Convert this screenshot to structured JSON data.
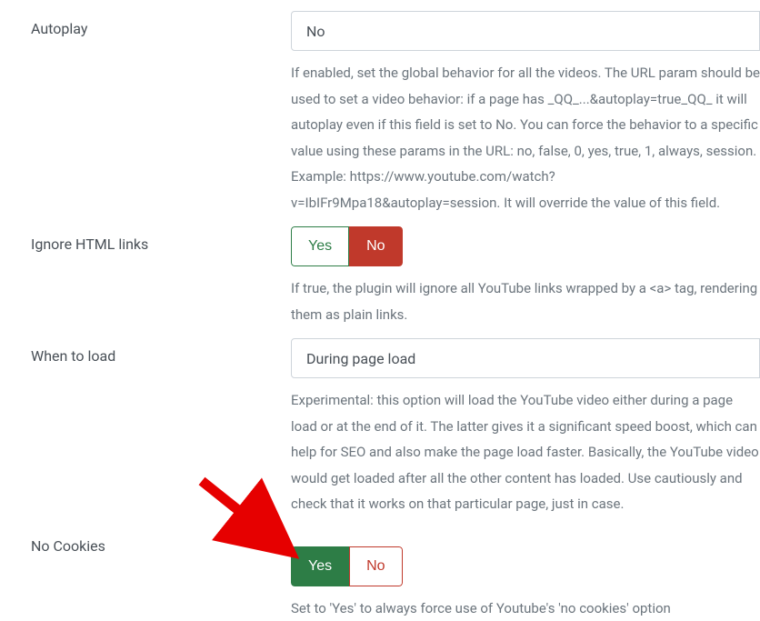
{
  "fields": {
    "autoplay": {
      "label": "Autoplay",
      "select_value": "No",
      "help": "If enabled, set the global behavior for all the videos. The URL param should be used to set a video behavior: if a page has _QQ_...&autoplay=true_QQ_ it will autoplay even if this field is set to No. You can force the behavior to a specific value using these params in the URL: no, false, 0, yes, true, 1, always, session. Example: https://www.youtube.com/watch?v=IbIFr9Mpa18&autoplay=session. It will override the value of this field."
    },
    "ignore_links": {
      "label": "Ignore HTML links",
      "btn_yes": "Yes",
      "btn_no": "No",
      "help": "If true, the plugin will ignore all YouTube links wrapped by a <a> tag, rendering them as plain links."
    },
    "when_to_load": {
      "label": "When to load",
      "select_value": "During page load",
      "help": "Experimental: this option will load the YouTube video either during a page load or at the end of it. The latter gives it a significant speed boost, which can help for SEO and also make the page load faster. Basically, the YouTube video would get loaded after all the other content has loaded. Use cautiously and check that it works on that particular page, just in case."
    },
    "no_cookies": {
      "label": "No Cookies",
      "btn_yes": "Yes",
      "btn_no": "No",
      "help": "Set to 'Yes' to always force use of Youtube's 'no cookies' option"
    }
  }
}
